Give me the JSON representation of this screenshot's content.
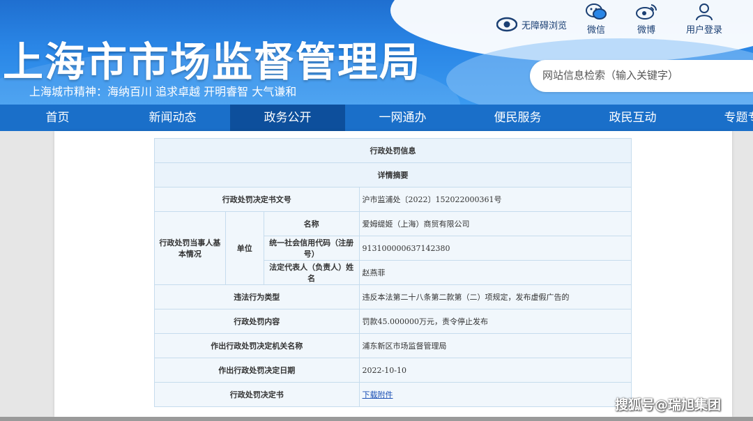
{
  "header": {
    "site_title": "上海市市场监督管理局",
    "slogan": "上海城市精神：海纳百川   追求卓越   开明睿智   大气谦和",
    "accessibility": "无障碍浏览",
    "links": [
      {
        "label": "微信",
        "icon": "wechat-icon"
      },
      {
        "label": "微博",
        "icon": "weibo-icon"
      },
      {
        "label": "用户登录",
        "icon": "user-icon"
      }
    ],
    "search_placeholder": "网站信息检索（输入关键字）"
  },
  "nav": {
    "items": [
      "首页",
      "新闻动态",
      "政务公开",
      "一网通办",
      "便民服务",
      "政民互动",
      "专题专栏"
    ],
    "active": "政务公开"
  },
  "table": {
    "title": "行政处罚信息",
    "subtitle": "详情摘要",
    "doc_no_label": "行政处罚决定书文号",
    "doc_no_value": "沪市监浦处〔2022〕152022000361号",
    "party_label": "行政处罚当事人基本情况",
    "unit_label": "单位",
    "name_label": "名称",
    "name_value": "爱姆缇姬（上海）商贸有限公司",
    "credit_label": "统一社会信用代码（注册号）",
    "credit_value": "913100000637142380",
    "rep_label": "法定代表人（负责人）姓名",
    "rep_value": "赵燕菲",
    "violation_label": "违法行为类型",
    "violation_value": "违反本法第二十八条第二款第（二）项规定，发布虚假广告的",
    "penalty_label": "行政处罚内容",
    "penalty_value": "罚款45.000000万元，责令停止发布",
    "authority_label": "作出行政处罚决定机关名称",
    "authority_value": "浦东新区市场监督管理局",
    "date_label": "作出行政处罚决定日期",
    "date_value": "2022-10-10",
    "doc_label": "行政处罚决定书",
    "doc_link": "下载附件"
  },
  "watermark": "搜狐号@瑞旭集团"
}
